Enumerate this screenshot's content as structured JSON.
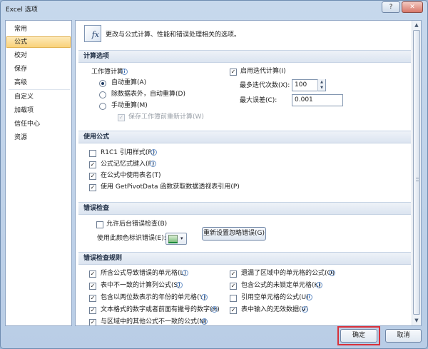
{
  "window": {
    "title": "Excel 选项",
    "help_label": "?",
    "close_label": "✕"
  },
  "sidebar": {
    "items": [
      {
        "label": "常用",
        "active": false
      },
      {
        "label": "公式",
        "active": true
      },
      {
        "label": "校对",
        "active": false
      },
      {
        "label": "保存",
        "active": false
      },
      {
        "label": "高级",
        "active": false
      },
      {
        "label": "自定义",
        "active": false
      },
      {
        "label": "加载项",
        "active": false
      },
      {
        "label": "信任中心",
        "active": false
      },
      {
        "label": "资源",
        "active": false
      }
    ]
  },
  "header": {
    "icon": "fx-icon",
    "icon_text": "fx",
    "text": "更改与公式计算、性能和错误处理相关的选项。"
  },
  "calc": {
    "title": "计算选项",
    "workbook_calc_label": "工作簿计算",
    "opt_auto": "自动重算(A)",
    "opt_auto_except": "除数据表外，自动重算(D)",
    "opt_manual": "手动重算(M)",
    "recalc_before_save": "保存工作簿前重新计算(W)",
    "iterative_label": "启用迭代计算(I)",
    "max_iter_label": "最多迭代次数(X):",
    "max_iter_value": "100",
    "max_change_label": "最大误差(C):",
    "max_change_value": "0.001"
  },
  "formulas": {
    "title": "使用公式",
    "r1c1": "R1C1 引用样式(R)",
    "autocomplete": "公式记忆式键入(F)",
    "table_names": "在公式中使用表名(T)",
    "getpivot": "使用 GetPivotData 函数获取数据透视表引用(P)"
  },
  "error_check": {
    "title": "错误检查",
    "background": "允许后台错误检查(B)",
    "color_label": "使用此颜色标识错误(E):",
    "reset_button": "重新设置忽略错误(G)"
  },
  "rules": {
    "title": "错误检查规则",
    "left": [
      "所含公式导致错误的单元格(L)",
      "表中不一致的计算列公式(S)",
      "包含以两位数表示的年份的单元格(Y)",
      "文本格式的数字或者前面有撇号的数字(H)",
      "与区域中的其他公式不一致的公式(N)"
    ],
    "right": [
      "遗漏了区域中的单元格的公式(O)",
      "包含公式的未锁定单元格(K)",
      "引用空单元格的公式(U)",
      "表中输入的无效数据(V)"
    ]
  },
  "footer": {
    "ok": "确定",
    "cancel": "取消"
  },
  "scrollbar": {
    "up": "▲",
    "down": "▼"
  },
  "check_mark": "✓",
  "info_mark": "i",
  "caret_mark": "▾",
  "spin": {
    "up": "▲",
    "down": "▼"
  },
  "colors": {
    "accent": "#f9d27a",
    "highlight_border": "#d8303a",
    "section_bg": "#dbe4f0"
  }
}
